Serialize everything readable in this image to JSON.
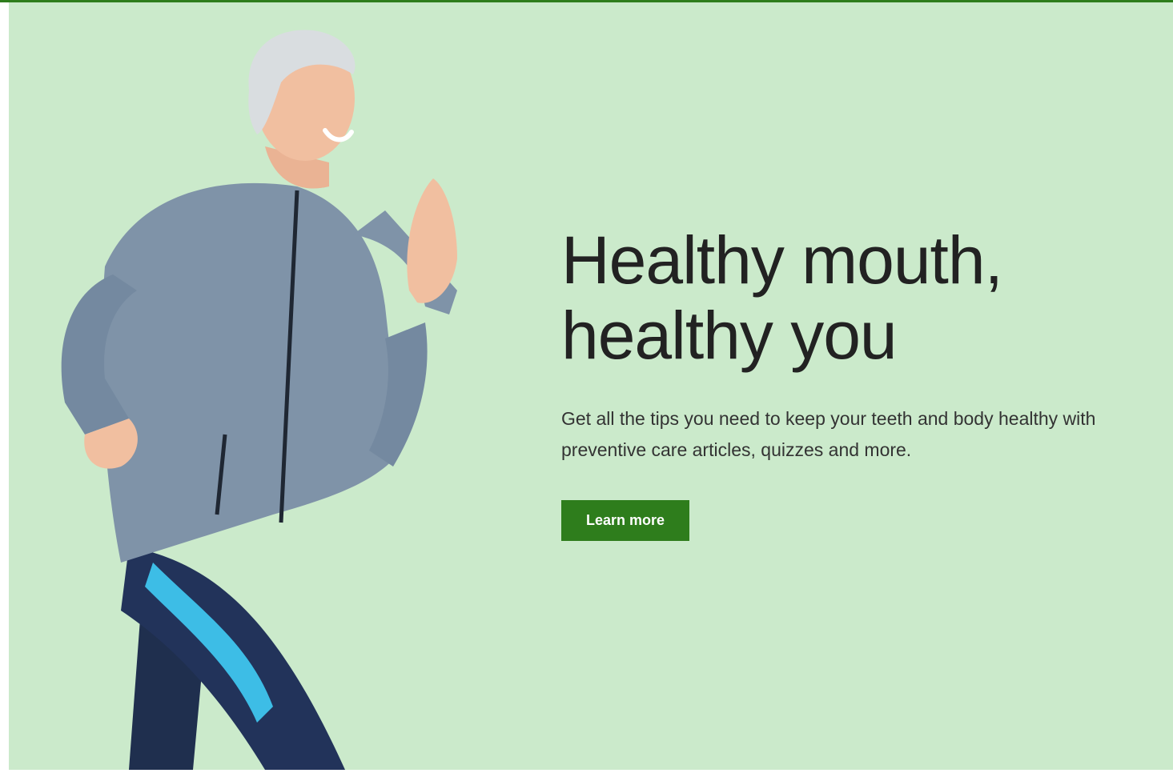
{
  "hero": {
    "headline_line1": "Healthy mouth,",
    "headline_line2": "healthy you",
    "body": "Get all the tips you need to keep your teeth and body healthy with preventive care articles, quizzes and more.",
    "cta_label": "Learn more",
    "photo_icon": "woman-jogging-photo"
  },
  "colors": {
    "accent": "#2e7d1c",
    "hero_background": "#cbeacb",
    "headline": "#222222",
    "body_text": "#333333"
  }
}
